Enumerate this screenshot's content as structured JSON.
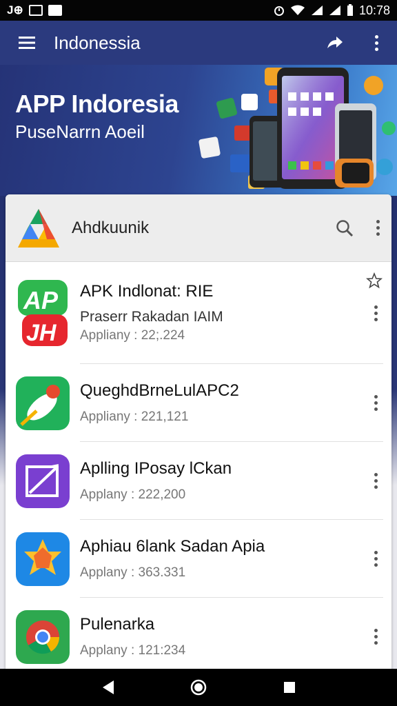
{
  "status_bar": {
    "left_text": "J⊕",
    "time": "10:78"
  },
  "app_bar": {
    "title": "Indonessia"
  },
  "hero": {
    "title": "APP Indoresia",
    "subtitle": "PuseNarrn Aoeil"
  },
  "card": {
    "header_title": "Ahdkuunik"
  },
  "apps": [
    {
      "title": "APK Indlonat: RIE",
      "subtitle": "Praserr Rakadan IAIM",
      "meta": "Appliany : 22;.224",
      "icon": "ap-green-red-icon"
    },
    {
      "title": "QueghdBrneLulAPC2",
      "subtitle": "",
      "meta": "Appliany : 221,121",
      "icon": "green-feather-icon"
    },
    {
      "title": "Aplling IPosay lCkan",
      "subtitle": "",
      "meta": "Applany : 222,200",
      "icon": "purple-edit-icon"
    },
    {
      "title": "Aphiau 6lank Sadan Apia",
      "subtitle": "",
      "meta": "Applany : 363.331",
      "icon": "blue-star-icon"
    },
    {
      "title": "Pulenarka",
      "subtitle": "",
      "meta": "Applany : 121:234",
      "icon": "chrome-icon"
    }
  ],
  "colors": {
    "app_bar": "#2b3a7e",
    "hero_start": "#253377",
    "hero_end": "#58a6e8",
    "card_header": "#ededed"
  }
}
